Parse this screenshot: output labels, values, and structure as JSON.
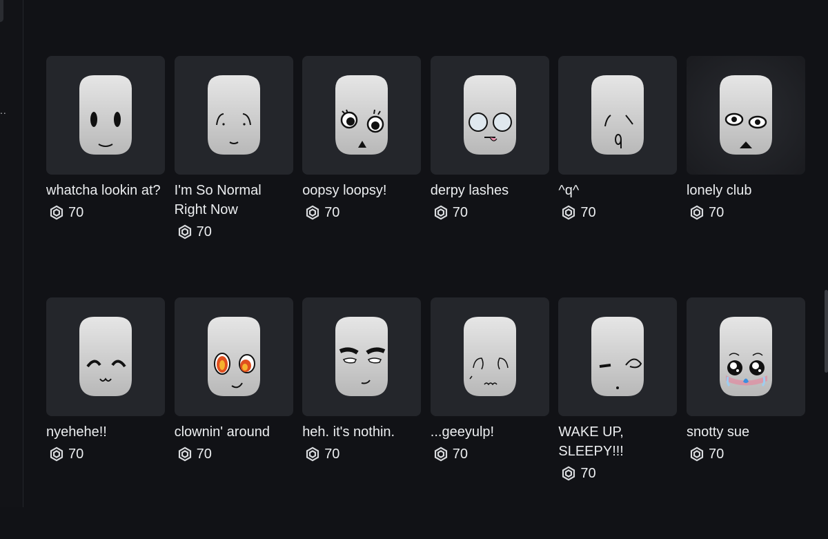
{
  "sidebar": {
    "ellipsis": "..",
    "icon": "more-icon"
  },
  "currency_icon": "robux-icon",
  "items": [
    {
      "name": "whatcha lookin at?",
      "price": "70",
      "face": "whatcha"
    },
    {
      "name": "I'm So Normal Right Now",
      "price": "70",
      "face": "normal"
    },
    {
      "name": "oopsy loopsy!",
      "price": "70",
      "face": "oopsy"
    },
    {
      "name": "derpy lashes",
      "price": "70",
      "face": "derpy"
    },
    {
      "name": "^q^",
      "price": "70",
      "face": "q"
    },
    {
      "name": "lonely club",
      "price": "70",
      "face": "lonely"
    },
    {
      "name": "nyehehe!!",
      "price": "70",
      "face": "nyehehe"
    },
    {
      "name": "clownin' around",
      "price": "70",
      "face": "clown"
    },
    {
      "name": "heh. it's nothin.",
      "price": "70",
      "face": "heh"
    },
    {
      "name": "...geeyulp!",
      "price": "70",
      "face": "gulp"
    },
    {
      "name": "WAKE UP, SLEEPY!!!",
      "price": "70",
      "face": "wake"
    },
    {
      "name": "snotty sue",
      "price": "70",
      "face": "snotty"
    }
  ]
}
